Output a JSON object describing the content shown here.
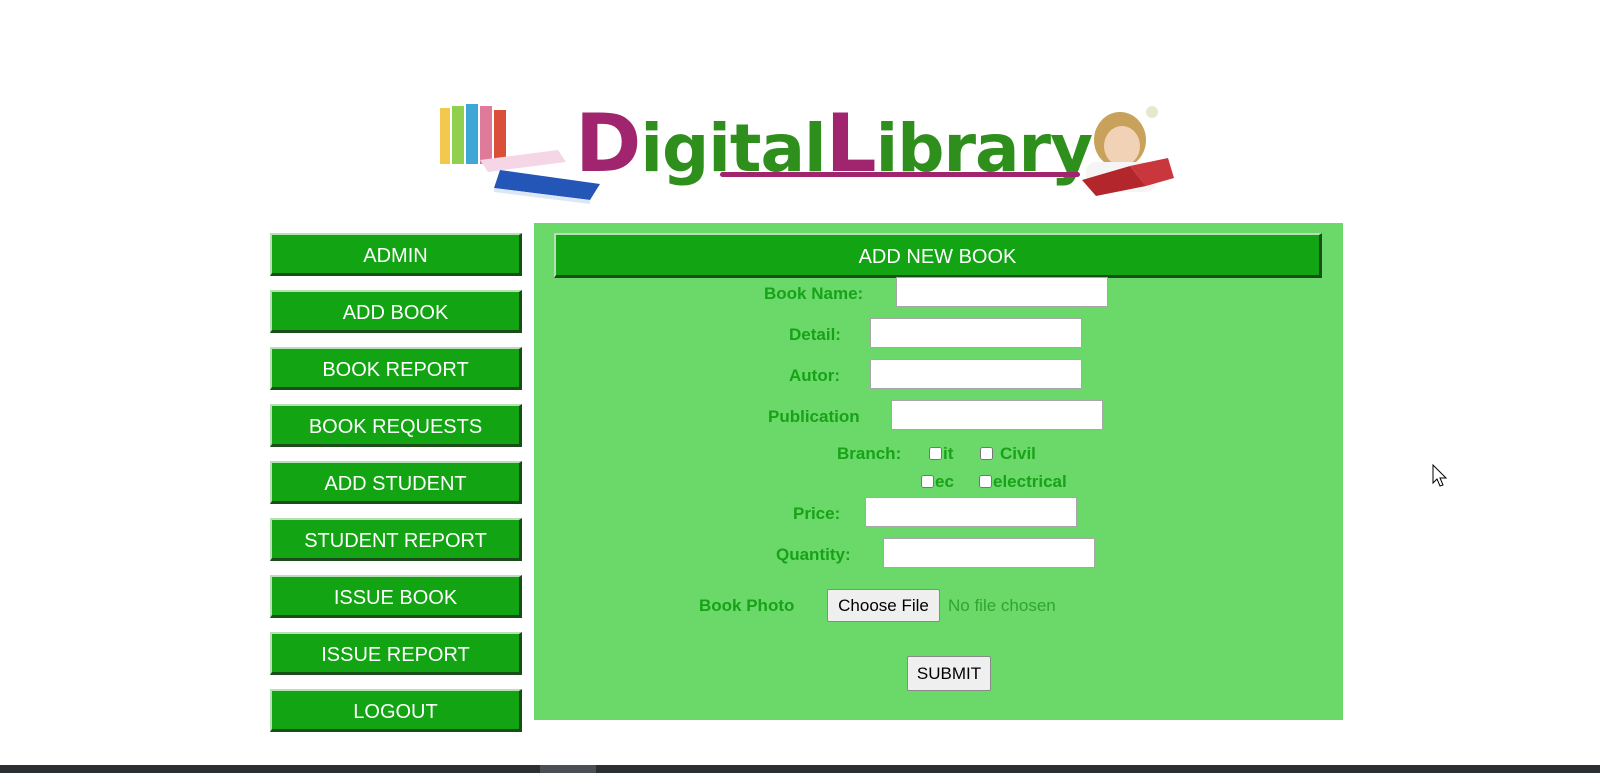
{
  "logo": {
    "part1_initial": "D",
    "part1_rest": "igital",
    "part2_initial": "L",
    "part2_rest": "ibrary",
    "colors": {
      "initials": "#a0246e",
      "rest": "#2f8f1c"
    }
  },
  "sidebar": {
    "items": [
      {
        "label": "ADMIN"
      },
      {
        "label": "ADD BOOK"
      },
      {
        "label": "BOOK REPORT"
      },
      {
        "label": "BOOK REQUESTS"
      },
      {
        "label": "ADD STUDENT"
      },
      {
        "label": "STUDENT REPORT"
      },
      {
        "label": "ISSUE BOOK"
      },
      {
        "label": "ISSUE REPORT"
      },
      {
        "label": "LOGOUT"
      }
    ]
  },
  "form": {
    "title": "ADD NEW BOOK",
    "book_name_label": "Book Name:",
    "detail_label": "Detail:",
    "autor_label": "Autor:",
    "publication_label": "Publication",
    "branch_label": "Branch:",
    "branches": [
      {
        "label": "it",
        "checked": false
      },
      {
        "label": "Civil",
        "checked": false
      },
      {
        "label": "ec",
        "checked": false
      },
      {
        "label": "electrical",
        "checked": false
      }
    ],
    "price_label": "Price:",
    "quantity_label": "Quantity:",
    "photo_label": "Book Photo",
    "choose_file_label": "Choose File",
    "file_status": "No file chosen",
    "submit_label": "SUBMIT",
    "values": {
      "book_name": "",
      "detail": "",
      "autor": "",
      "publication": "",
      "price": "",
      "quantity": ""
    }
  },
  "colors": {
    "nav_green": "#12a412",
    "panel_green": "#6ad96a",
    "label_green": "#18a218"
  }
}
